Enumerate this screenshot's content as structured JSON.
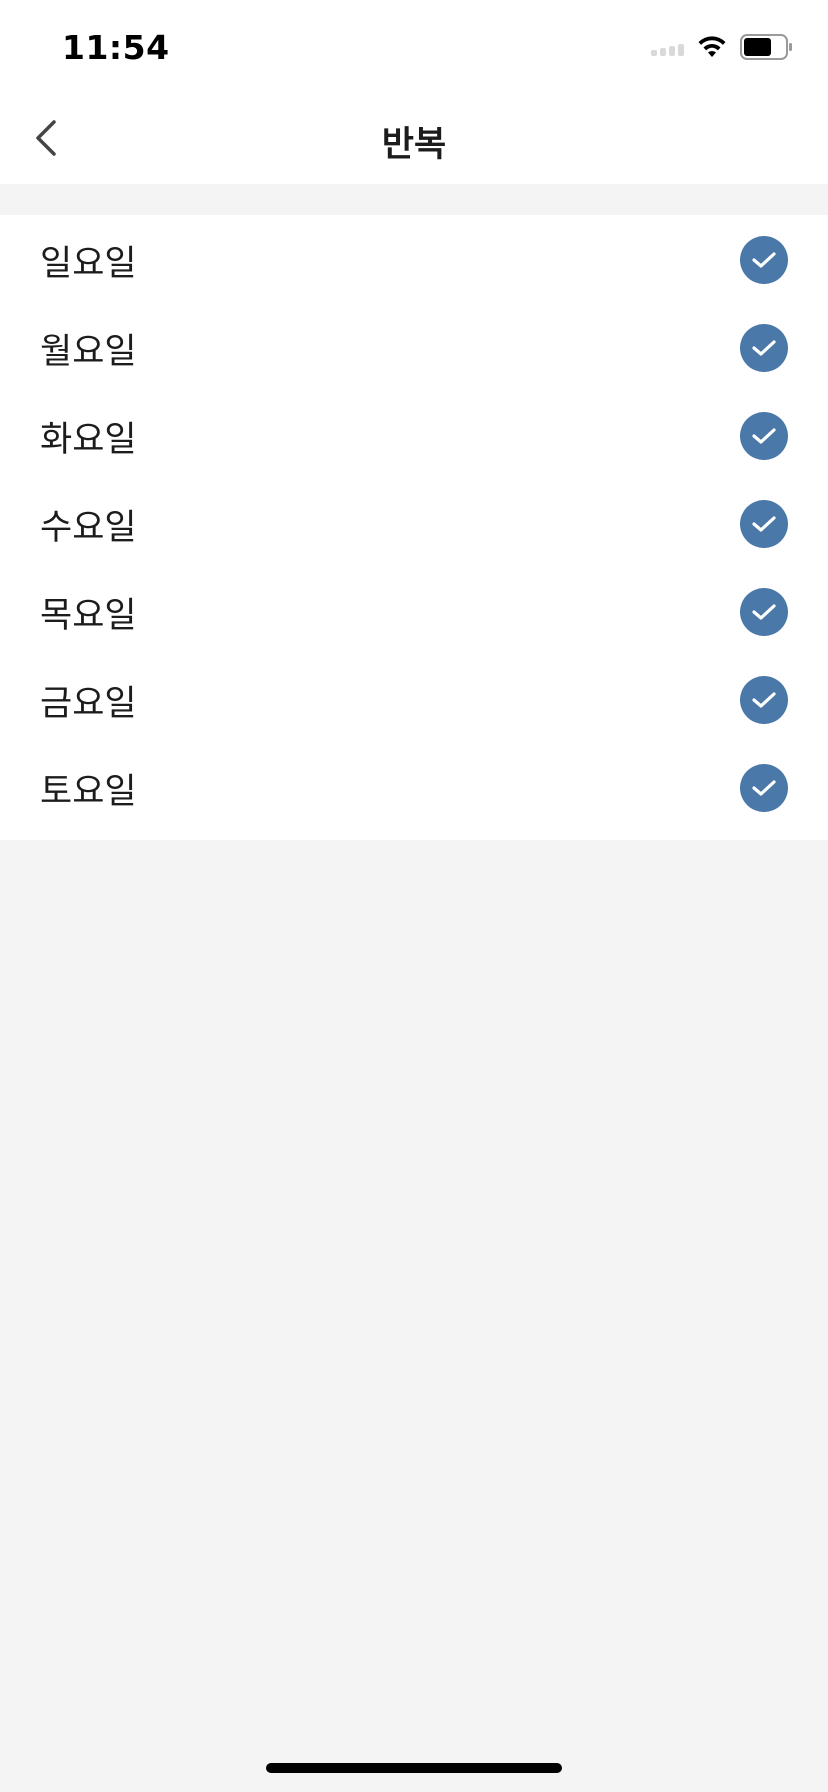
{
  "status_bar": {
    "time": "11:54"
  },
  "nav": {
    "title": "반복"
  },
  "days": [
    {
      "label": "일요일",
      "checked": true
    },
    {
      "label": "월요일",
      "checked": true
    },
    {
      "label": "화요일",
      "checked": true
    },
    {
      "label": "수요일",
      "checked": true
    },
    {
      "label": "목요일",
      "checked": true
    },
    {
      "label": "금요일",
      "checked": true
    },
    {
      "label": "토요일",
      "checked": true
    }
  ],
  "colors": {
    "accent": "#4a78a8",
    "background": "#f4f4f4",
    "surface": "#ffffff"
  },
  "icons": {
    "back": "chevron-left-icon",
    "check": "check-icon",
    "wifi": "wifi-icon",
    "battery": "battery-icon",
    "signal": "cellular-signal-icon"
  }
}
